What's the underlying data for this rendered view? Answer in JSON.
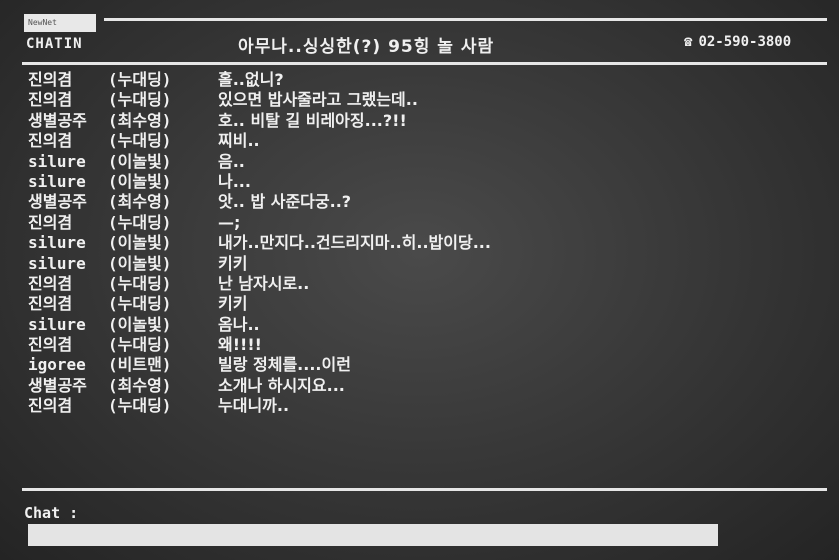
{
  "header": {
    "badge_text": "NewNet",
    "brand": "CHATIN",
    "title": "아무나..싱싱한(?) 95힝 놀 사람",
    "phone": "02-590-3800",
    "phone_icon": "telephone-icon"
  },
  "messages": [
    {
      "user": "진의겸",
      "nick": "(누대딩)",
      "text": "홀..없니?"
    },
    {
      "user": "진의겸",
      "nick": "(누대딩)",
      "text": "있으면 밥사줄라고 그랬는데.."
    },
    {
      "user": "생별공주",
      "nick": "(최수영)",
      "text": "호.. 비탈 길 비레아징...?!!"
    },
    {
      "user": "진의겸",
      "nick": "(누대딩)",
      "text": "찌비.."
    },
    {
      "user": "silure",
      "nick": "(이놀빛)",
      "text": "음.."
    },
    {
      "user": "silure",
      "nick": "(이놀빛)",
      "text": "나..."
    },
    {
      "user": "생별공주",
      "nick": "(최수영)",
      "text": "앗.. 밥 사준다궁..?"
    },
    {
      "user": "진의겸",
      "nick": "(누대딩)",
      "text": "—;"
    },
    {
      "user": "silure",
      "nick": "(이놀빛)",
      "text": "내가..만지다..건드리지마..히..밥이당..."
    },
    {
      "user": "silure",
      "nick": "(이놀빛)",
      "text": "키키"
    },
    {
      "user": "진의겸",
      "nick": "(누대딩)",
      "text": "난 남자시로.."
    },
    {
      "user": "진의겸",
      "nick": "(누대딩)",
      "text": "키키"
    },
    {
      "user": "silure",
      "nick": "(이놀빛)",
      "text": "옴나.."
    },
    {
      "user": "진의겸",
      "nick": "(누대딩)",
      "text": "왜!!!!"
    },
    {
      "user": "igoree",
      "nick": "(비트맨)",
      "text": "빌랑 정체를....이런"
    },
    {
      "user": "생별공주",
      "nick": "(최수영)",
      "text": "소개나 하시지요..."
    },
    {
      "user": "진의겸",
      "nick": "(누대딩)",
      "text": "누대니까.."
    }
  ],
  "chat": {
    "label": "Chat :",
    "value": "",
    "placeholder": ""
  }
}
